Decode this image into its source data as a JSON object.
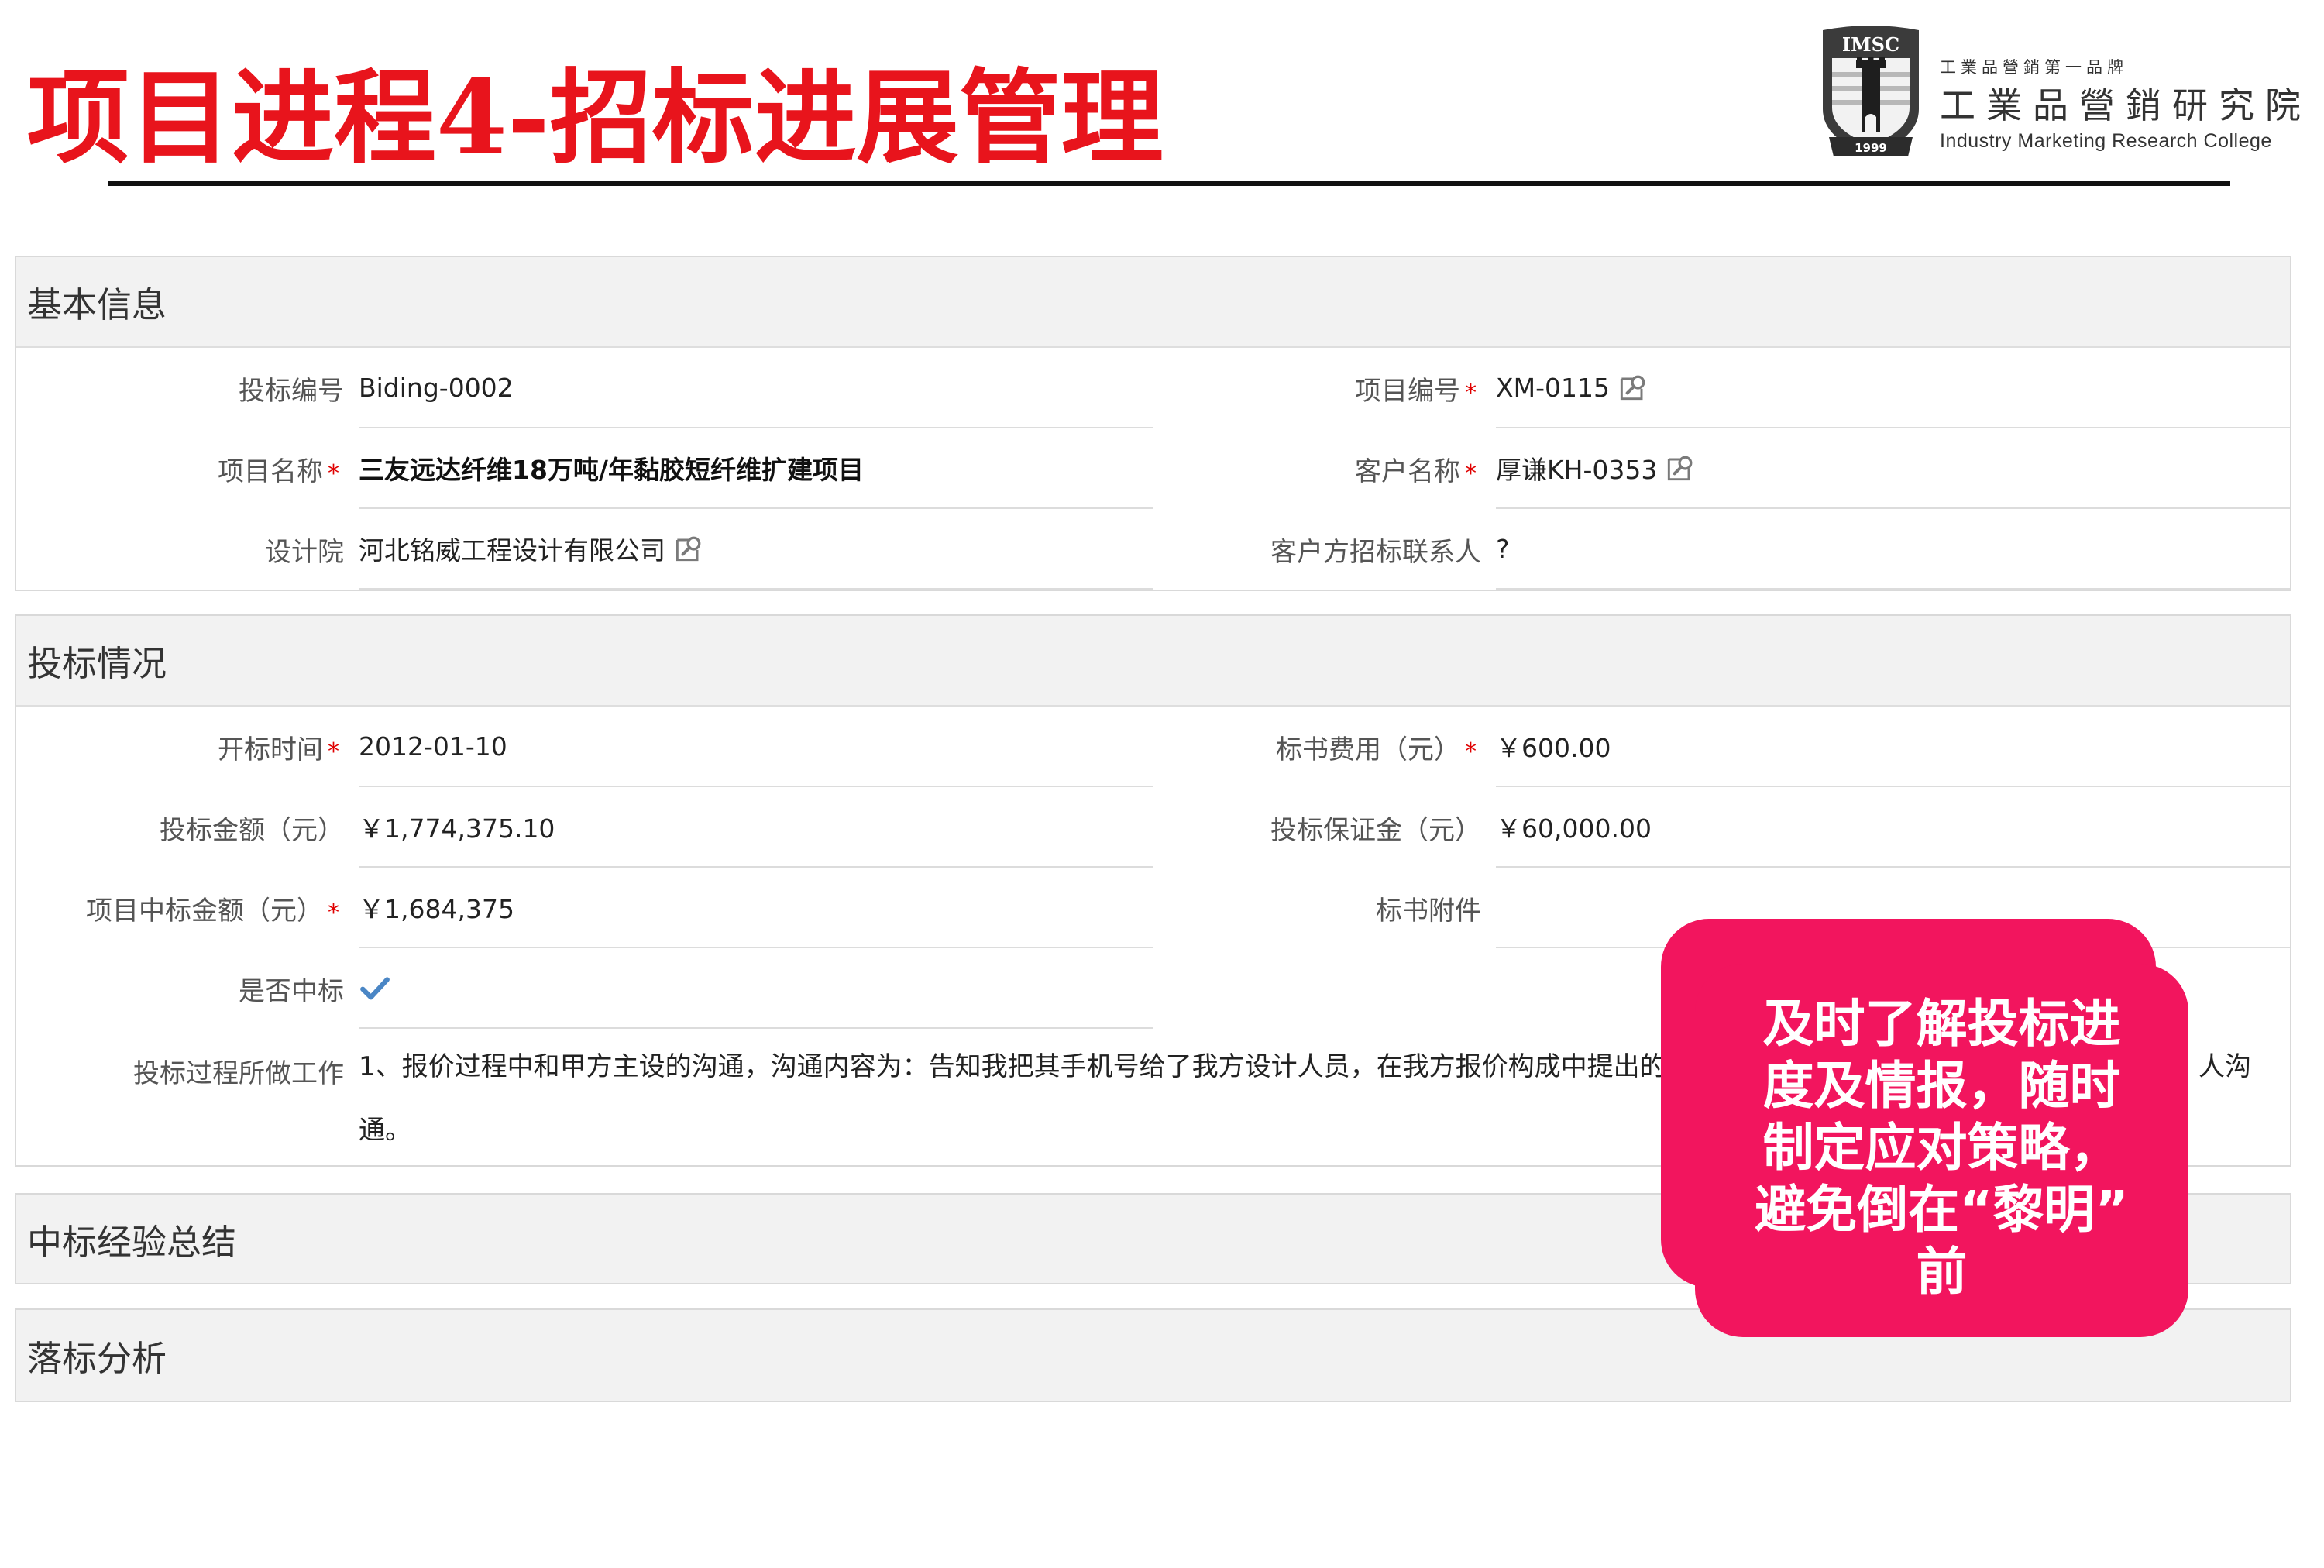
{
  "slide": {
    "title": "项目进程4-招标进展管理"
  },
  "logo": {
    "badge_text": "IMSC",
    "badge_year": "1999",
    "tagline": "工業品營銷第一品牌",
    "name_cn": "工業品營銷研究院",
    "name_en": "Industry Marketing Research College"
  },
  "required_mark": "*",
  "icons": {
    "lookup": "lookup-icon",
    "won": "check-icon",
    "logo": "shield-emblem-icon"
  },
  "basic_info": {
    "header": "基本信息",
    "bid_no": {
      "label": "投标编号",
      "value": "Biding-0002"
    },
    "project_no": {
      "label": "项目编号",
      "value": "XM-0115",
      "required": true
    },
    "project_name": {
      "label": "项目名称",
      "value": "三友远达纤维18万吨/年黏胶短纤维扩建项目",
      "required": true
    },
    "customer_name": {
      "label": "客户名称",
      "value": "厚谦KH-0353",
      "required": true
    },
    "design_institute": {
      "label": "设计院",
      "value": "河北铭威工程设计有限公司"
    },
    "customer_contact": {
      "label": "客户方招标联系人",
      "value": "?"
    }
  },
  "bid_status": {
    "header": "投标情况",
    "opening_date": {
      "label": "开标时间",
      "value": "2012-01-10",
      "required": true
    },
    "tender_fee": {
      "label": "标书费用（元）",
      "value": "￥600.00",
      "required": true
    },
    "bid_amount": {
      "label": "投标金额（元）",
      "value": "￥1,774,375.10"
    },
    "bid_bond": {
      "label": "投标保证金（元）",
      "value": "￥60,000.00"
    },
    "award_amount": {
      "label": "项目中标金额（元）",
      "value": "￥1,684,375",
      "required": true
    },
    "attachment": {
      "label": "标书附件",
      "value": ""
    },
    "won": {
      "label": "是否中标",
      "checked": true
    },
    "work_done": {
      "label": "投标过程所做工作",
      "lines": [
        "1、报价过程中和甲方主设的沟通，沟通内容为：告知我把其手机号给了我方设计人员，在我方报价构成中提出的",
        "通。"
      ],
      "line1_end": "人沟"
    }
  },
  "win_summary": {
    "header": "中标经验总结"
  },
  "loss_analysis": {
    "header": "落标分析"
  },
  "callout": {
    "lines": [
      "及时了解投标进",
      "度及情报，随时",
      "制定应对策略，",
      "避免倒在“黎明”",
      "前"
    ]
  },
  "colors": {
    "title": "#e8141c",
    "callout": "#f2155e",
    "required": "#e00000",
    "check": "#4a86c5"
  }
}
